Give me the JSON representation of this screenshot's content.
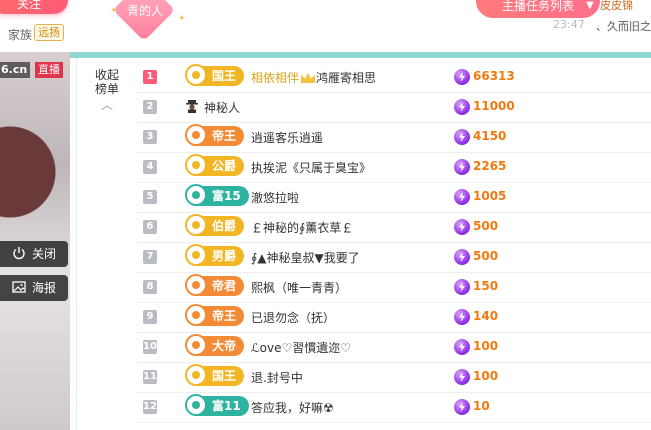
{
  "header": {
    "follow_label": "关注",
    "family_label": "家族",
    "family_tag": "远扬",
    "badge_text": "青的人",
    "task_button": "主播任务列表",
    "chat_top": "皮皮锦",
    "chat_time": "23:47",
    "chat_message": "、久而旧之"
  },
  "video": {
    "domain": "6.cn",
    "live_label": "直播",
    "close_label": "关闭",
    "poster_label": "海报"
  },
  "rank_panel": {
    "collapse_label": "收起\n榜单",
    "collapse_line1": "收起",
    "collapse_line2": "榜单",
    "collapse_arrow": "︿",
    "rows": [
      {
        "rank": "1",
        "medal": "国王",
        "medal_color": "gold",
        "name": "相依相伴",
        "name2": "鸿雁寄相思",
        "score": "66313"
      },
      {
        "rank": "2",
        "medal": "",
        "medal_color": "",
        "name": "神秘人",
        "name2": "",
        "score": "11000"
      },
      {
        "rank": "3",
        "medal": "帝王",
        "medal_color": "orange",
        "name": "逍遥客乐逍遥",
        "name2": "",
        "score": "4150"
      },
      {
        "rank": "4",
        "medal": "公爵",
        "medal_color": "gold",
        "name": "执挨泥《只属于臭宝》",
        "name2": "",
        "score": "2265"
      },
      {
        "rank": "5",
        "medal": "富15",
        "medal_color": "teal",
        "name": "澈悠拉啦",
        "name2": "",
        "score": "1005"
      },
      {
        "rank": "6",
        "medal": "伯爵",
        "medal_color": "gold",
        "name": "￡神秘的∮薰衣草￡",
        "name2": "",
        "score": "500"
      },
      {
        "rank": "7",
        "medal": "男爵",
        "medal_color": "gold",
        "name": "∮▲神秘皇叔▼我要了",
        "name2": "",
        "score": "500"
      },
      {
        "rank": "8",
        "medal": "帝君",
        "medal_color": "orange",
        "name": "熙枫（唯一青青）",
        "name2": "",
        "score": "150"
      },
      {
        "rank": "9",
        "medal": "帝王",
        "medal_color": "orange",
        "name": "已退勿念（抚）",
        "name2": "",
        "score": "140"
      },
      {
        "rank": "10",
        "medal": "大帝",
        "medal_color": "orange",
        "name": "ℒove♡習慣遺迩♡",
        "name2": "",
        "score": "100"
      },
      {
        "rank": "11",
        "medal": "国王",
        "medal_color": "gold",
        "name": "退.封号中",
        "name2": "",
        "score": "100"
      },
      {
        "rank": "12",
        "medal": "富11",
        "medal_color": "teal",
        "name": "答应我，好嘛☢",
        "name2": "",
        "score": "10"
      }
    ]
  }
}
